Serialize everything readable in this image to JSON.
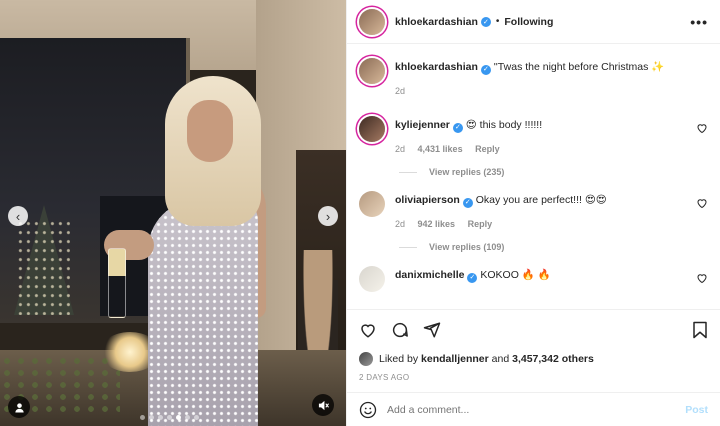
{
  "post": {
    "author": "khloekardashian",
    "follow_status": "Following",
    "separator": "•",
    "more": "•••"
  },
  "caption": {
    "username": "khloekardashian",
    "text": "''Twas the night before Christmas ✨",
    "time": "2d"
  },
  "comments": [
    {
      "username": "kyliejenner",
      "text": "😍 this body !!!!!!",
      "time": "2d",
      "likes": "4,431 likes",
      "reply": "Reply",
      "replies": "View replies (235)"
    },
    {
      "username": "oliviapierson",
      "text": "Okay you are perfect!!! 😍😍",
      "time": "2d",
      "likes": "942 likes",
      "reply": "Reply",
      "replies": "View replies (109)"
    },
    {
      "username": "danixmichelle",
      "text": "KOKOO 🔥 🔥",
      "time": "",
      "likes": "",
      "reply": "",
      "replies": ""
    }
  ],
  "likes": {
    "prefix": "Liked by",
    "user": "kendalljenner",
    "and": "and",
    "others": "3,457,342 others"
  },
  "date": "2 DAYS AGO",
  "add_comment": {
    "placeholder": "Add a comment...",
    "post_label": "Post"
  },
  "carousel": {
    "prev": "‹",
    "next": "›",
    "dot_count": 7,
    "active_dot": 4
  },
  "colors": {
    "verified": "#3897f0",
    "story_ring": "#d6249f",
    "post_button": "#b2dffc"
  }
}
